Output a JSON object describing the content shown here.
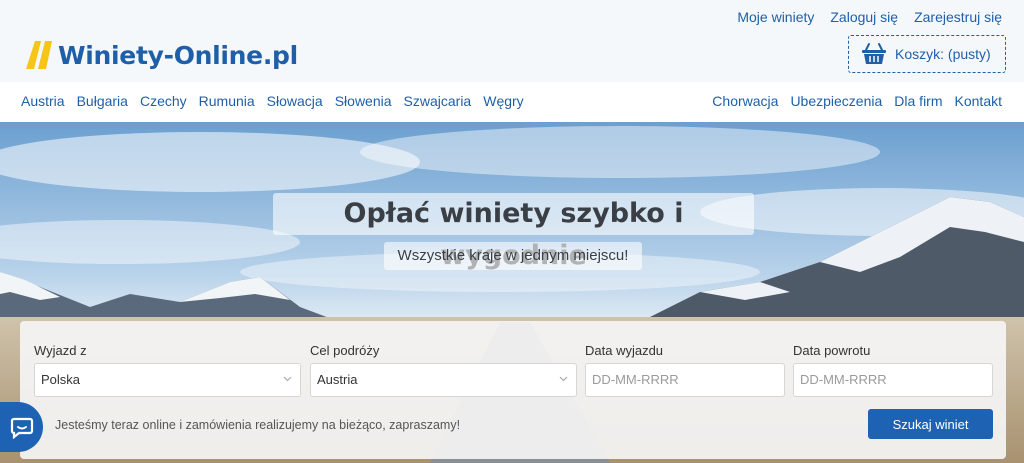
{
  "brand": {
    "name": "Winiety-Online.pl",
    "colors": {
      "primary": "#1f5fa8",
      "accent": "#f5c518",
      "button": "#1e63b3"
    }
  },
  "top_links": [
    "Moje winiety",
    "Zaloguj się",
    "Zarejestruj się"
  ],
  "cart": {
    "label": "Koszyk: (pusty)",
    "icon": "basket-icon"
  },
  "nav": {
    "left": [
      "Austria",
      "Bułgaria",
      "Czechy",
      "Rumunia",
      "Słowacja",
      "Słowenia",
      "Szwajcaria",
      "Węgry"
    ],
    "right": [
      "Chorwacja",
      "Ubezpieczenia",
      "Dla firm",
      "Kontakt"
    ]
  },
  "hero": {
    "headline": "Opłać winiety szybko i wygodnie",
    "subline": "Wszystkie kraje w jednym miejscu!"
  },
  "search": {
    "departure": {
      "label": "Wyjazd z",
      "value": "Polska"
    },
    "destination": {
      "label": "Cel podróży",
      "value": "Austria"
    },
    "date_from": {
      "label": "Data wyjazdu",
      "placeholder": "DD-MM-RRRR"
    },
    "date_to": {
      "label": "Data powrotu",
      "placeholder": "DD-MM-RRRR"
    },
    "status": "Jesteśmy teraz online i zamówienia realizujemy na bieżąco, zapraszamy!",
    "button": "Szukaj winiet"
  },
  "chat": {
    "icon": "chat-icon"
  }
}
